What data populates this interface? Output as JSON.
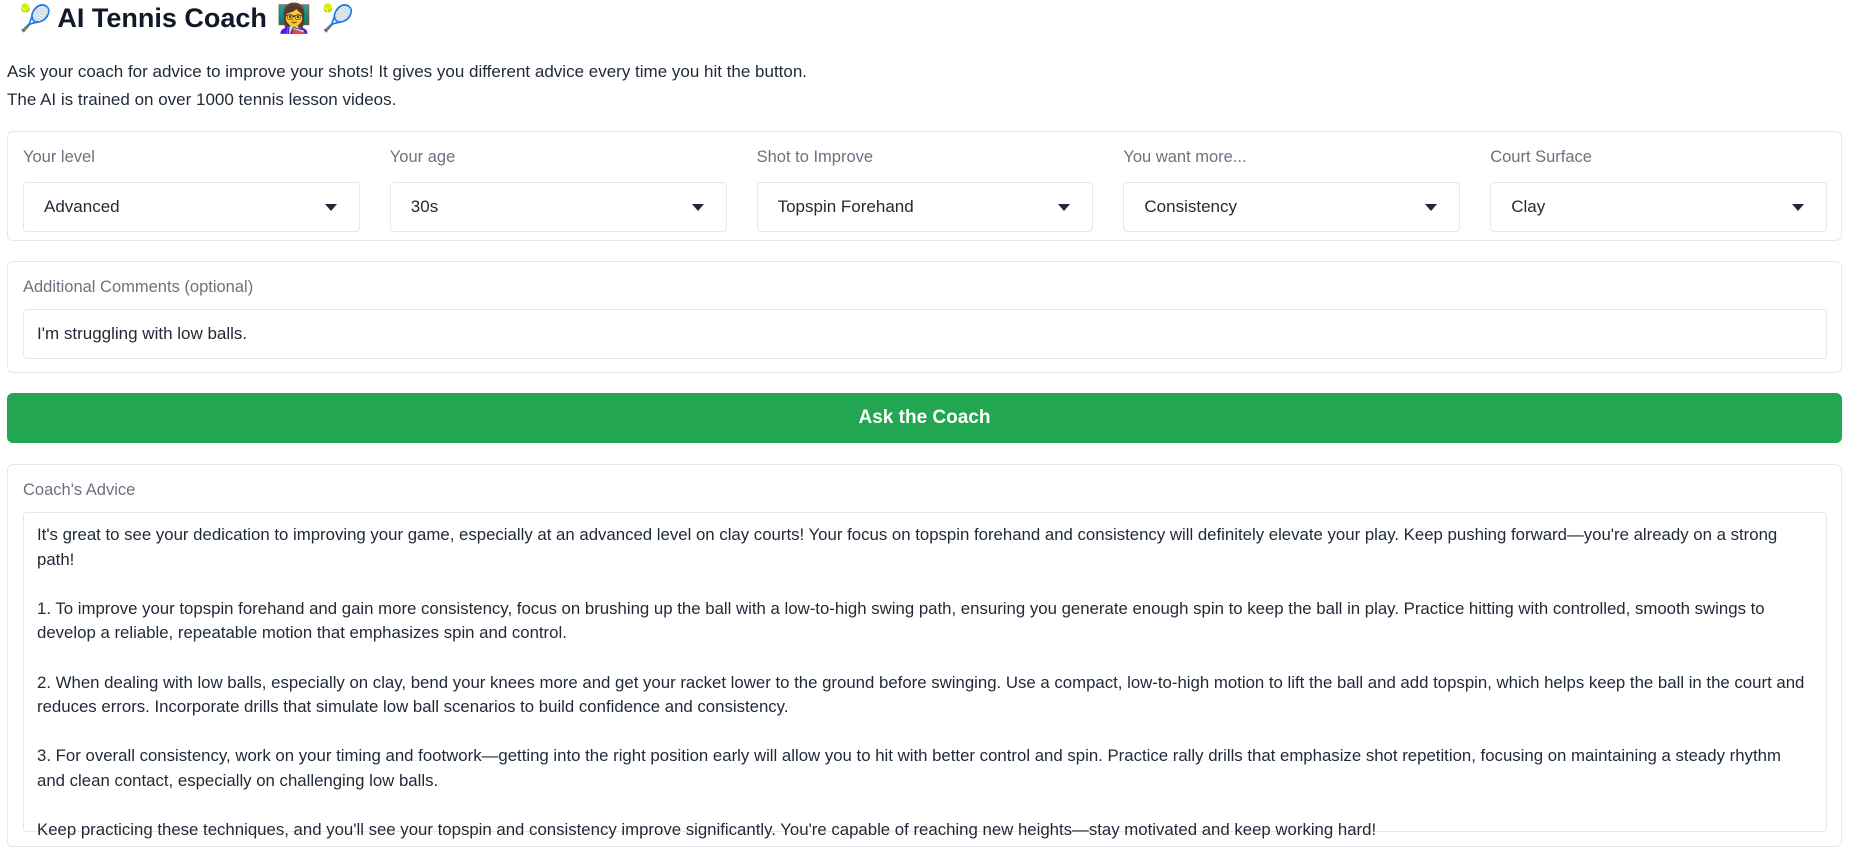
{
  "header": {
    "title": "AI Tennis Coach",
    "racket_emoji": "🎾",
    "coach_emoji": "👩‍🏫"
  },
  "description": {
    "line1": "Ask your coach for advice to improve your shots! It gives you different advice every time you hit the button.",
    "line2": "The AI is trained on over 1000 tennis lesson videos."
  },
  "dropdowns": [
    {
      "label": "Your level",
      "value": "Advanced"
    },
    {
      "label": "Your age",
      "value": "30s"
    },
    {
      "label": "Shot to Improve",
      "value": "Topspin Forehand"
    },
    {
      "label": "You want more...",
      "value": "Consistency"
    },
    {
      "label": "Court Surface",
      "value": "Clay"
    }
  ],
  "comments": {
    "label": "Additional Comments (optional)",
    "value": "I'm struggling with low balls."
  },
  "ask_button_label": "Ask the Coach",
  "advice": {
    "label": "Coach's Advice",
    "paragraphs": [
      "It's great to see your dedication to improving your game, especially at an advanced level on clay courts! Your focus on topspin forehand and consistency will definitely elevate your play. Keep pushing forward—you're already on a strong path!",
      "1. To improve your topspin forehand and gain more consistency, focus on brushing up the ball with a low-to-high swing path, ensuring you generate enough spin to keep the ball in play. Practice hitting with controlled, smooth swings to develop a reliable, repeatable motion that emphasizes spin and control.",
      "2. When dealing with low balls, especially on clay, bend your knees more and get your racket lower to the ground before swinging. Use a compact, low-to-high motion to lift the ball and add topspin, which helps keep the ball in the court and reduces errors. Incorporate drills that simulate low ball scenarios to build confidence and consistency.",
      "3. For overall consistency, work on your timing and footwork—getting into the right position early will allow you to hit with better control and spin. Practice rally drills that emphasize shot repetition, focusing on maintaining a steady rhythm and clean contact, especially on challenging low balls.",
      "Keep practicing these techniques, and you'll see your topspin and consistency improve significantly. You're capable of reaching new heights—stay motivated and keep working hard!"
    ]
  },
  "colors": {
    "primary_button": "#22a652",
    "border": "#e5e7eb",
    "label_text": "#6b7280"
  }
}
